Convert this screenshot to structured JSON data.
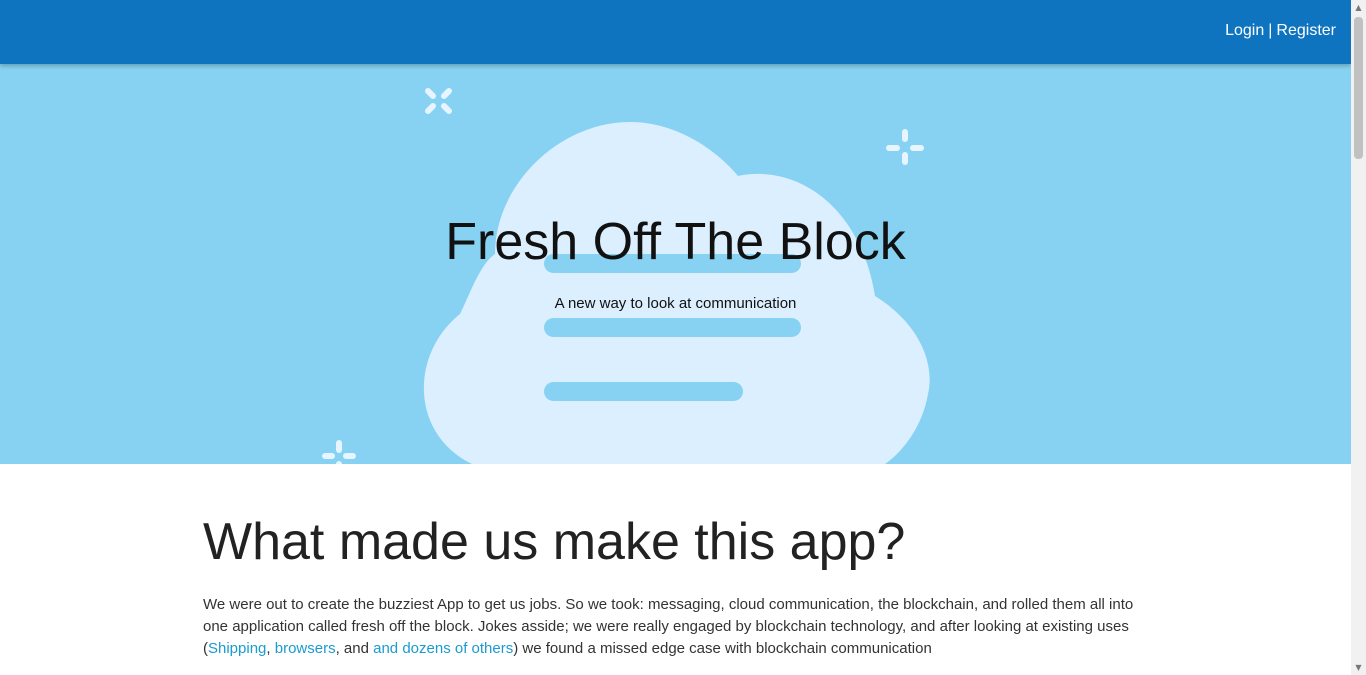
{
  "header": {
    "login_label": "Login",
    "separator": "|",
    "register_label": "Register"
  },
  "hero": {
    "title": "Fresh Off The Block",
    "subtitle": "A new way to look at communication"
  },
  "about": {
    "heading": "What made us make this app?",
    "text_before": "We were out to create the buzziest App to get us jobs. So we took: messaging, cloud communication, the blockchain, and rolled them all into one application called fresh off the block. Jokes asside; we were really engaged by blockchain technology, and after looking at existing uses (",
    "link_shipping": "Shipping",
    "comma": ", ",
    "link_browsers": "browsers",
    "and_text": ", and ",
    "link_others": "and dozens of others",
    "text_after": ") we found a missed edge case with blockchain communication"
  },
  "colors": {
    "header_bg": "#0f74c0",
    "hero_bg": "#87d2f2",
    "cloud": "#dcefff",
    "link": "#1a9bd0"
  },
  "icons": [
    "sparkle-icon",
    "cloud-illustration"
  ]
}
